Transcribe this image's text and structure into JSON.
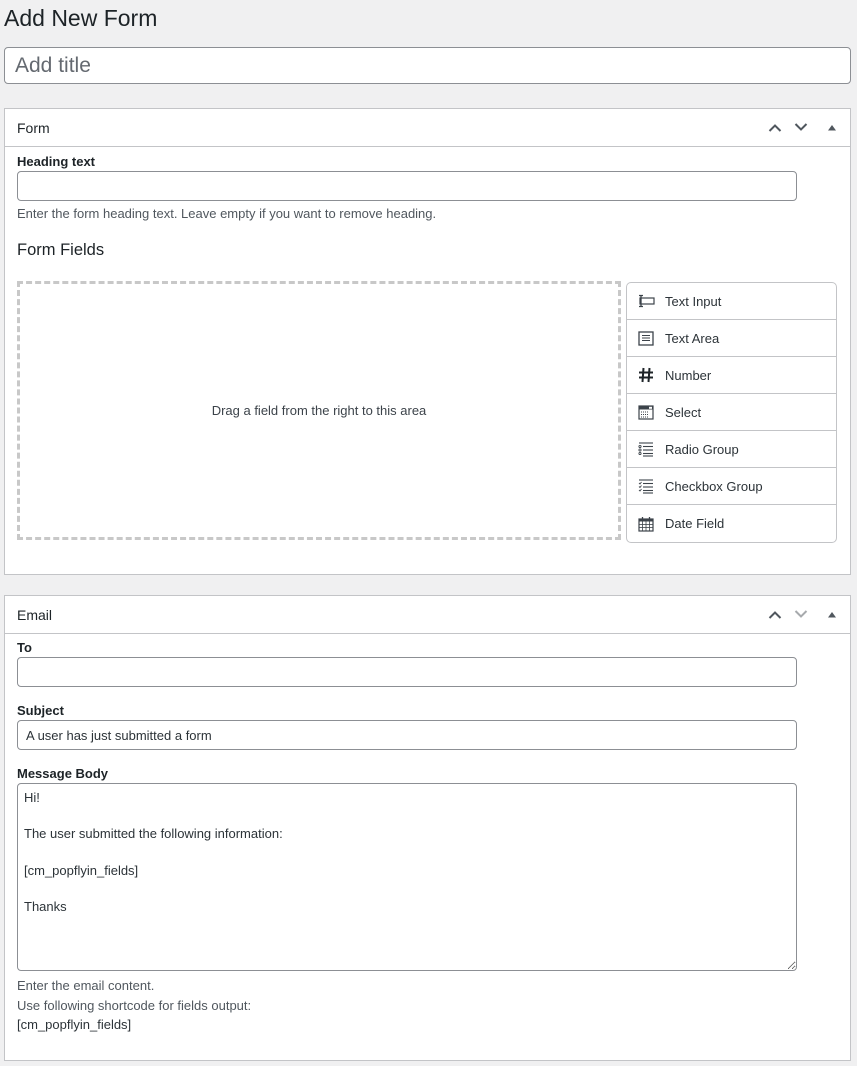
{
  "page": {
    "title": "Add New Form",
    "title_input": {
      "value": "",
      "placeholder": "Add title"
    }
  },
  "form_box": {
    "title": "Form",
    "heading_label": "Heading text",
    "heading_value": "",
    "heading_description": "Enter the form heading text. Leave empty if you want to remove heading.",
    "fields_heading": "Form Fields",
    "dropzone_text": "Drag a field from the right to this area",
    "palette": [
      {
        "label": "Text Input",
        "icon": "text-input-icon"
      },
      {
        "label": "Text Area",
        "icon": "text-area-icon"
      },
      {
        "label": "Number",
        "icon": "hash-icon"
      },
      {
        "label": "Select",
        "icon": "select-icon"
      },
      {
        "label": "Radio Group",
        "icon": "radio-list-icon"
      },
      {
        "label": "Checkbox Group",
        "icon": "checkbox-list-icon"
      },
      {
        "label": "Date Field",
        "icon": "calendar-icon"
      }
    ],
    "move_up_label": "Move up",
    "move_down_label": "Move down",
    "toggle_label": "Toggle panel"
  },
  "email_box": {
    "title": "Email",
    "to_label": "To",
    "to_value": "",
    "subject_label": "Subject",
    "subject_value": "A user has just submitted a form",
    "message_label": "Message Body",
    "message_value": "Hi!\n\nThe user submitted the following information:\n\n[cm_popflyin_fields]\n\nThanks",
    "help_line1": "Enter the email content.",
    "help_line2": "Use following shortcode for fields output:",
    "shortcode": "[cm_popflyin_fields]",
    "move_down_disabled": true
  },
  "colors": {
    "background": "#f0f0f1",
    "panel_border": "#c3c4c7",
    "input_border": "#8c8f94",
    "text": "#1d2327",
    "muted_text": "#50575e"
  }
}
